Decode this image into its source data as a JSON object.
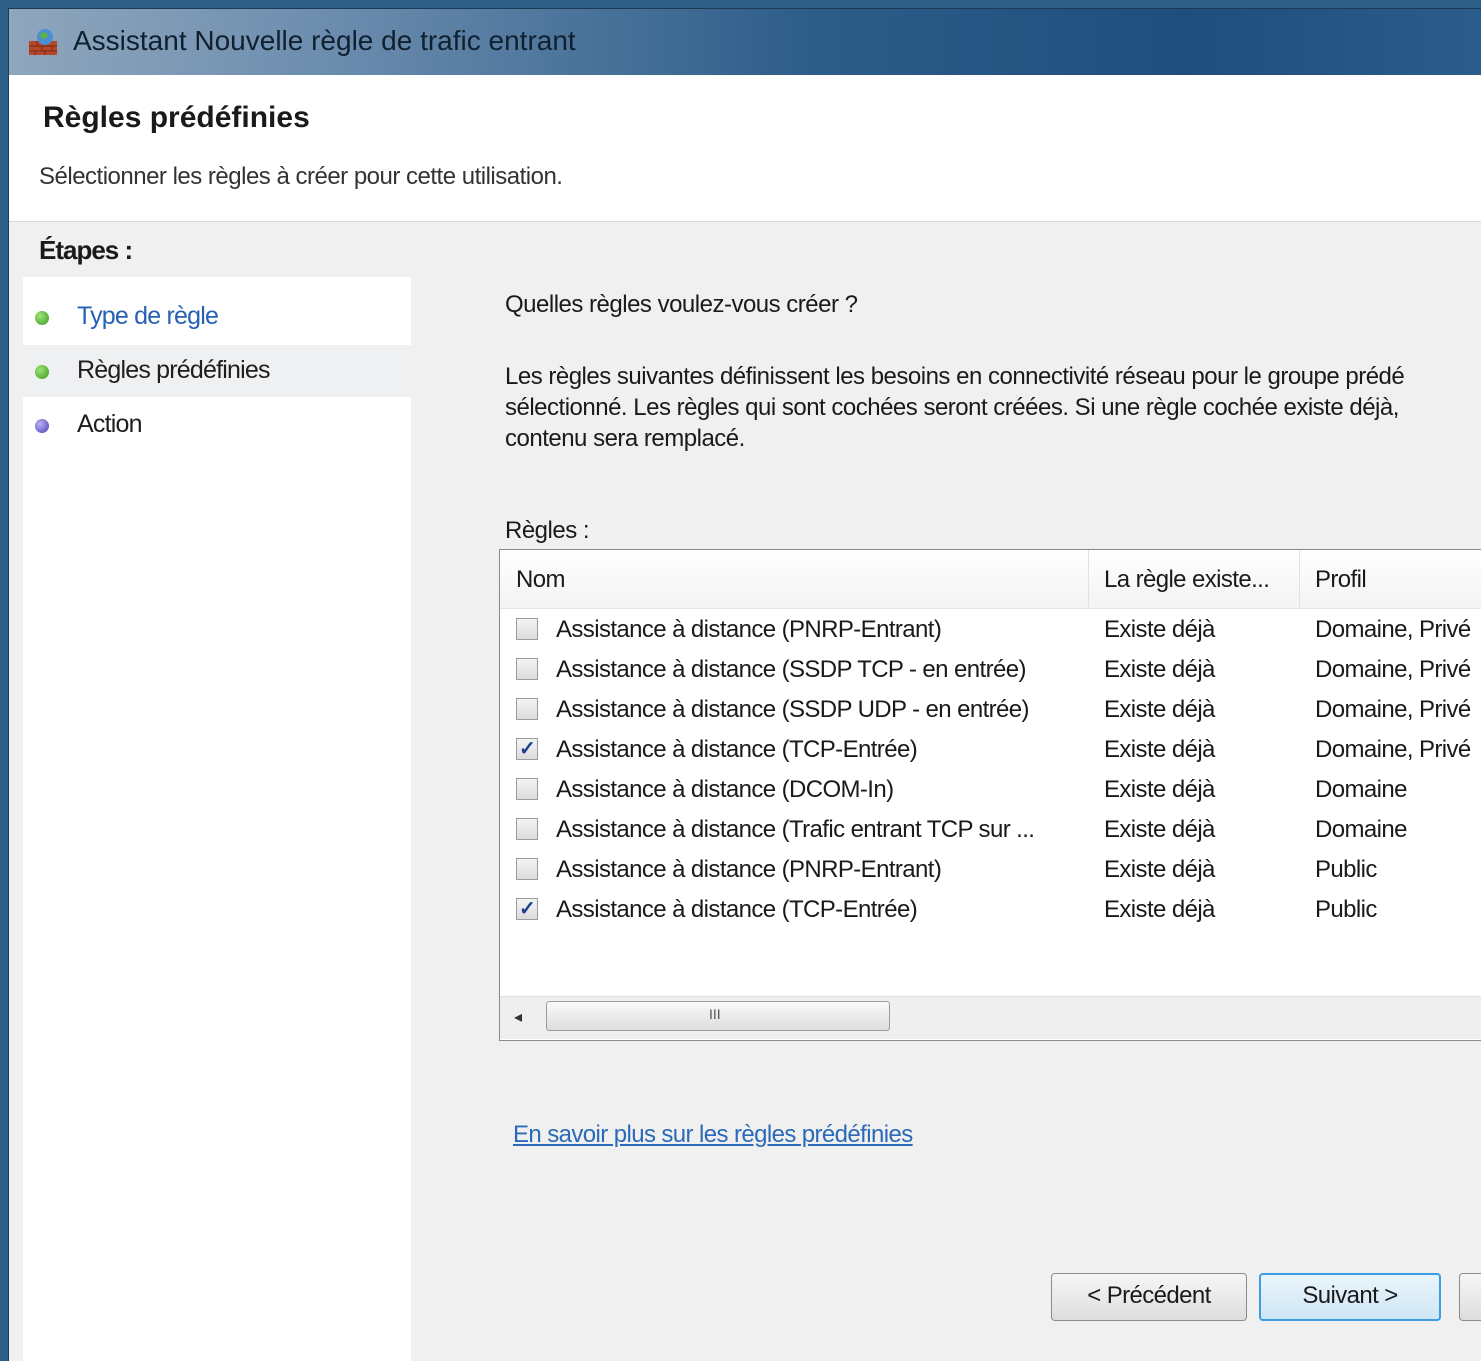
{
  "window": {
    "title": "Assistant Nouvelle règle de trafic entrant"
  },
  "header": {
    "title": "Règles prédéfinies",
    "subtitle": "Sélectionner les règles à créer pour cette utilisation."
  },
  "sidebar": {
    "title": "Étapes :",
    "steps": [
      {
        "label": "Type de règle",
        "state": "link"
      },
      {
        "label": "Règles prédéfinies",
        "state": "current"
      },
      {
        "label": "Action",
        "state": "pending"
      }
    ]
  },
  "main": {
    "question": "Quelles règles voulez-vous créer ?",
    "description": "Les règles suivantes définissent les besoins en connectivité réseau pour le groupe prédé\nsélectionné. Les règles qui sont cochées seront créées. Si une règle cochée existe déjà,\ncontenu sera remplacé.",
    "rules_label": "Règles :",
    "columns": [
      "Nom",
      "La règle existe...",
      "Profil"
    ],
    "rows": [
      {
        "checked": false,
        "name": "Assistance à distance (PNRP-Entrant)",
        "exists": "Existe déjà",
        "profile": "Domaine, Privé"
      },
      {
        "checked": false,
        "name": "Assistance à distance (SSDP TCP - en entrée)",
        "exists": "Existe déjà",
        "profile": "Domaine, Privé"
      },
      {
        "checked": false,
        "name": "Assistance à distance (SSDP UDP - en entrée)",
        "exists": "Existe déjà",
        "profile": "Domaine, Privé"
      },
      {
        "checked": true,
        "name": "Assistance à distance (TCP-Entrée)",
        "exists": "Existe déjà",
        "profile": "Domaine, Privé"
      },
      {
        "checked": false,
        "name": "Assistance à distance (DCOM-In)",
        "exists": "Existe déjà",
        "profile": "Domaine"
      },
      {
        "checked": false,
        "name": "Assistance à distance (Trafic entrant TCP sur ...",
        "exists": "Existe déjà",
        "profile": "Domaine"
      },
      {
        "checked": false,
        "name": "Assistance à distance (PNRP-Entrant)",
        "exists": "Existe déjà",
        "profile": "Public"
      },
      {
        "checked": true,
        "name": "Assistance à distance (TCP-Entrée)",
        "exists": "Existe déjà",
        "profile": "Public"
      }
    ],
    "learn_more_link": "En savoir plus sur les règles prédéfinies"
  },
  "buttons": {
    "previous": "< Précédent",
    "next": "Suivant >",
    "cancel": ""
  },
  "icons": {
    "app": "firewall-icon",
    "check": "✓",
    "scroll_left": "◂",
    "scroll_grip": "III"
  }
}
